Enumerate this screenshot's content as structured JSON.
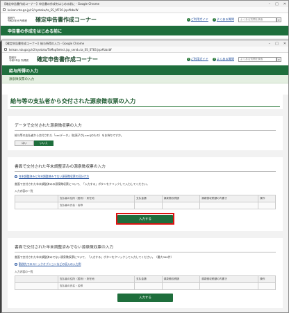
{
  "back_window": {
    "title": "【確定申告書作成コーナー】申告書の作成をはじめる前に - Google Chrome",
    "url": "keisan.nta.go.jp/r2/syotoku/ta_SS_M720.jsp#bbxW",
    "header": {
      "era_line1": "国税庁",
      "era_line2": "令和2年分 所得税",
      "site_title": "確定申告書作成コーナー",
      "guide": "ご利用ガイド",
      "faq": "よくある質問",
      "search_placeholder": "よくある質問を検索"
    },
    "green_bar": "申告書の作成をはじめる前に"
  },
  "front_window": {
    "title": "【確定申告書作成コーナー】給与所得の入力 - Google Chrome",
    "url": "keisan.nta.go.jp/r2/syotoku/TaMapSelect.jsp_send=ta_SS_ST83.jsp#bbxW",
    "header": {
      "era_line1": "国税庁",
      "era_line2": "令和2年分 所得税",
      "site_title": "確定申告書作成コーナー",
      "guide": "ご利用ガイド",
      "faq": "よくある質問",
      "search_placeholder": "よくある質問を検索"
    },
    "green_bar": "給与所得の入力",
    "section_bar": "源泉徴収票の入力",
    "page_heading": "給与等の支払者から交付された源泉徴収票の入力",
    "panel1": {
      "heading": "データで交付された源泉徴収票の入力",
      "text": "給与等の支払者から交付された「xmlデータ」（拡張子が[.xml]のもの）をお持ちですか。",
      "yes": "はい",
      "no": "いいえ"
    },
    "panel2": {
      "heading": "書面で交付された年末調整済みの源泉徴収票の入力",
      "link": "年末調整済みと年末調整済みでない源泉徴収票の見分け方",
      "text": "書面で交付された年末調整済みの源泉徴収票について、「入力する」ボタンをクリックして入力してください。",
      "table_label": "入力内容の一覧",
      "columns": [
        "支払者の住所（居所）・所在地",
        "支払金額",
        "源泉徴収税額",
        "源泉徴収税額の内書き",
        "操作"
      ],
      "row2": "支払者の氏名・名称",
      "button": "入力する"
    },
    "panel3": {
      "heading": "書面で交付された年末調整済みでない源泉徴収票の入力",
      "text": "書面で交付された年末調整済みでない源泉徴収票について、「入力する」ボタンをクリックして入力してください。（最大300件）",
      "link": "勤務先でのストックオプションなどの収入の入力例",
      "table_label": "入力内容の一覧",
      "columns": [
        "支払者の住所（居所）・所在地",
        "支払金額",
        "源泉徴収税額",
        "源泉徴収税額の内書き",
        "操作"
      ],
      "row2": "支払者の氏名・名称",
      "button": "入力する"
    }
  }
}
